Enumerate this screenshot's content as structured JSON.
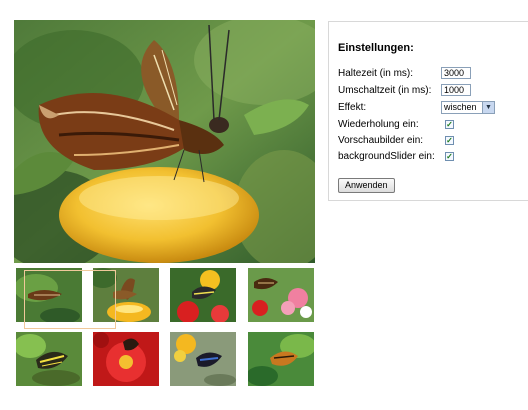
{
  "settings": {
    "title": "Einstellungen:",
    "hold_label": "Haltezeit (in ms):",
    "hold_value": "3000",
    "switch_label": "Umschaltzeit (in ms):",
    "switch_value": "1000",
    "effect_label": "Effekt:",
    "effect_value": "wischen",
    "repeat_label": "Wiederholung ein:",
    "repeat_checked": true,
    "preview_label": "Vorschaubilder ein:",
    "preview_checked": true,
    "bgslider_label": "backgroundSlider ein:",
    "bgslider_checked": true,
    "apply_label": "Anwenden"
  },
  "gallery": {
    "main_image_icon": "butterfly-on-orange-photo",
    "thumbnail_count": 8,
    "selected_thumbnail": 1
  }
}
